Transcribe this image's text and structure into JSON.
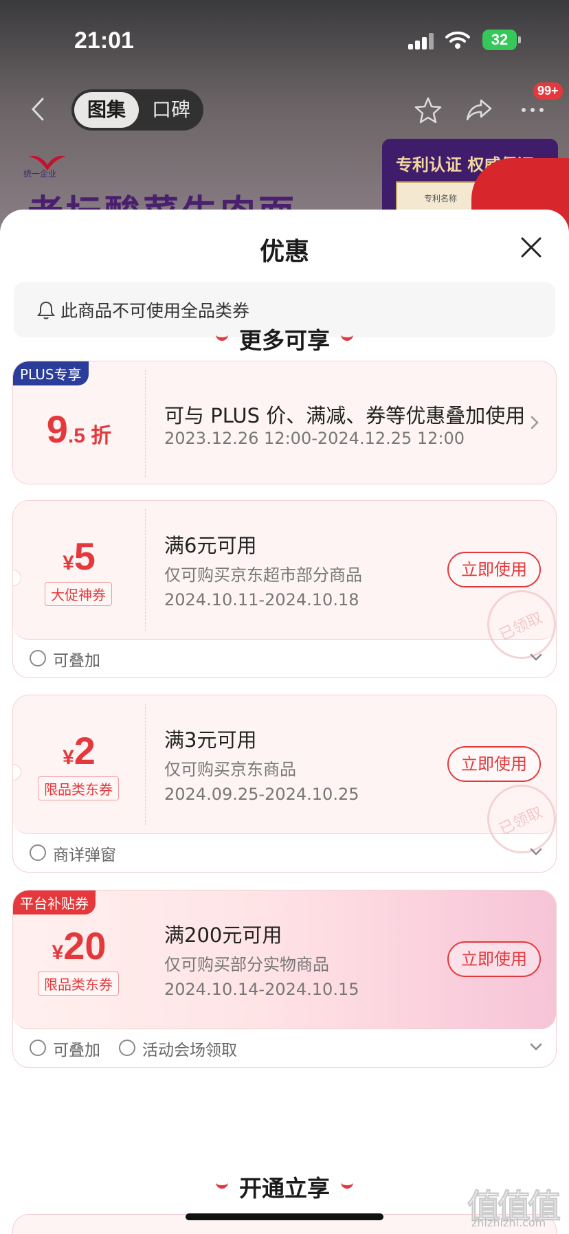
{
  "status_bar": {
    "time": "21:01",
    "battery": "32"
  },
  "navbar": {
    "tab_active": "图集",
    "tab_inactive": "口碑",
    "more_badge": "99+"
  },
  "background": {
    "brand": "统一企业",
    "headline": "老坛酸菜牛肉面",
    "promo": "专利认证 权威保证",
    "promo_sub": "专利名称"
  },
  "sheet": {
    "title": "优惠",
    "notice": "此商品不可使用全品类券",
    "section_more": "更多可享",
    "section_open": "开通立享",
    "coupons": [
      {
        "badge": "PLUS专享",
        "value_big": "9",
        "value_small": ".5 折",
        "line1": "可与 PLUS 价、满减、券等优惠叠加使用",
        "line2": "2023.12.26 12:00-2024.12.25 12:00"
      },
      {
        "currency": "¥",
        "value": "5",
        "tag": "大促神券",
        "line1": "满6元可用",
        "line2": "仅可购买京东超市部分商品",
        "line3": "2024.10.11-2024.10.18",
        "button": "立即使用",
        "stamp": "已领取",
        "foot": [
          "可叠加"
        ]
      },
      {
        "currency": "¥",
        "value": "2",
        "tag": "限品类东券",
        "line1": "满3元可用",
        "line2": "仅可购买京东商品",
        "line3": "2024.09.25-2024.10.25",
        "button": "立即使用",
        "stamp": "已领取",
        "foot": [
          "商详弹窗"
        ]
      },
      {
        "badge": "平台补贴券",
        "currency": "¥",
        "value": "20",
        "tag": "限品类东券",
        "line1": "满200元可用",
        "line2": "仅可购买部分实物商品",
        "line3": "2024.10.14-2024.10.15",
        "button": "立即使用",
        "foot": [
          "可叠加",
          "活动会场领取"
        ]
      }
    ]
  },
  "watermark": {
    "main": "值值值",
    "sub": "zhizhizhi.com"
  },
  "colors": {
    "accent": "#e4393c",
    "plus_badge": "#2a3d9b",
    "platform_badge": "#e4393c"
  }
}
